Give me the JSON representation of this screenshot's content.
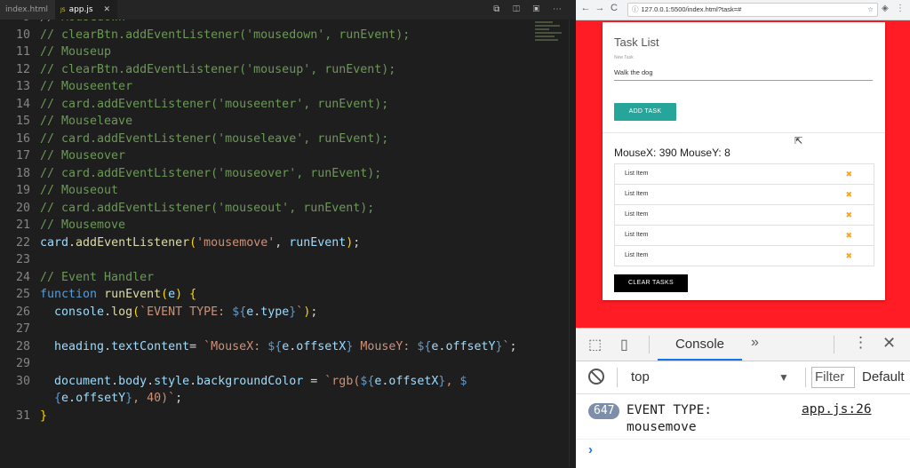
{
  "editor": {
    "tabs": [
      {
        "label": "index.html"
      },
      {
        "label": "app.js",
        "badge": "JS",
        "close": "✕"
      }
    ],
    "toolbar_icons": "⧉ ◫ ▣ ⋯",
    "lines": [
      {
        "n": "9",
        "segs": [
          [
            "c-com",
            "// Mousedown"
          ]
        ]
      },
      {
        "n": "10",
        "segs": [
          [
            "c-com",
            "// clearBtn.addEventListener('mousedown', runEvent);"
          ]
        ]
      },
      {
        "n": "11",
        "segs": [
          [
            "c-com",
            "// Mouseup"
          ]
        ]
      },
      {
        "n": "12",
        "segs": [
          [
            "c-com",
            "// clearBtn.addEventListener('mouseup', runEvent);"
          ]
        ]
      },
      {
        "n": "13",
        "segs": [
          [
            "c-com",
            "// Mouseenter"
          ]
        ]
      },
      {
        "n": "14",
        "segs": [
          [
            "c-com",
            "// card.addEventListener('mouseenter', runEvent);"
          ]
        ]
      },
      {
        "n": "15",
        "segs": [
          [
            "c-com",
            "// Mouseleave"
          ]
        ]
      },
      {
        "n": "16",
        "segs": [
          [
            "c-com",
            "// card.addEventListener('mouseleave', runEvent);"
          ]
        ]
      },
      {
        "n": "17",
        "segs": [
          [
            "c-com",
            "// Mouseover"
          ]
        ]
      },
      {
        "n": "18",
        "segs": [
          [
            "c-com",
            "// card.addEventListener('mouseover', runEvent);"
          ]
        ]
      },
      {
        "n": "19",
        "segs": [
          [
            "c-com",
            "// Mouseout"
          ]
        ]
      },
      {
        "n": "20",
        "segs": [
          [
            "c-com",
            "// card.addEventListener('mouseout', runEvent);"
          ]
        ]
      },
      {
        "n": "21",
        "segs": [
          [
            "c-com",
            "// Mousemove"
          ]
        ]
      },
      {
        "n": "22",
        "segs": [
          [
            "c-var",
            "card"
          ],
          [
            "c-w",
            "."
          ],
          [
            "c-fn",
            "addEventListener"
          ],
          [
            "c-p",
            "("
          ],
          [
            "c-str",
            "'mousemove'"
          ],
          [
            "c-w",
            ", "
          ],
          [
            "c-var",
            "runEvent"
          ],
          [
            "c-p",
            ")"
          ],
          [
            "c-w",
            ";"
          ]
        ]
      },
      {
        "n": "23",
        "segs": []
      },
      {
        "n": "24",
        "segs": [
          [
            "c-com",
            "// Event Handler"
          ]
        ]
      },
      {
        "n": "25",
        "segs": [
          [
            "c-kw",
            "function"
          ],
          [
            "c-w",
            " "
          ],
          [
            "c-fn",
            "runEvent"
          ],
          [
            "c-p",
            "("
          ],
          [
            "c-var",
            "e"
          ],
          [
            "c-p",
            ")"
          ],
          [
            "c-w",
            " "
          ],
          [
            "c-p",
            "{"
          ]
        ]
      },
      {
        "n": "26",
        "segs": [
          [
            "c-w",
            "  "
          ],
          [
            "c-var",
            "console"
          ],
          [
            "c-w",
            "."
          ],
          [
            "c-fn",
            "log"
          ],
          [
            "c-p",
            "("
          ],
          [
            "c-str",
            "`EVENT TYPE: "
          ],
          [
            "c-kw",
            "${"
          ],
          [
            "c-var",
            "e"
          ],
          [
            "c-w",
            "."
          ],
          [
            "c-var",
            "type"
          ],
          [
            "c-kw",
            "}"
          ],
          [
            "c-str",
            "`"
          ],
          [
            "c-p",
            ")"
          ],
          [
            "c-w",
            ";"
          ]
        ]
      },
      {
        "n": "27",
        "segs": []
      },
      {
        "n": "28",
        "segs": [
          [
            "c-w",
            "  "
          ],
          [
            "c-var",
            "heading"
          ],
          [
            "c-w",
            "."
          ],
          [
            "c-var",
            "textContent"
          ],
          [
            "c-w",
            "= "
          ],
          [
            "c-str",
            "`MouseX: "
          ],
          [
            "c-kw",
            "${"
          ],
          [
            "c-var",
            "e"
          ],
          [
            "c-w",
            "."
          ],
          [
            "c-var",
            "offsetX"
          ],
          [
            "c-kw",
            "}"
          ],
          [
            "c-str",
            " MouseY: "
          ],
          [
            "c-kw",
            "${"
          ],
          [
            "c-var",
            "e"
          ],
          [
            "c-w",
            "."
          ],
          [
            "c-var",
            "offsetY"
          ],
          [
            "c-kw",
            "}"
          ],
          [
            "c-str",
            "`"
          ],
          [
            "c-w",
            ";"
          ]
        ]
      },
      {
        "n": "29",
        "segs": []
      },
      {
        "n": "30",
        "segs": [
          [
            "c-w",
            "  "
          ],
          [
            "c-var",
            "document"
          ],
          [
            "c-w",
            "."
          ],
          [
            "c-var",
            "body"
          ],
          [
            "c-w",
            "."
          ],
          [
            "c-var",
            "style"
          ],
          [
            "c-w",
            "."
          ],
          [
            "c-var",
            "backgroundColor"
          ],
          [
            "c-w",
            " = "
          ],
          [
            "c-str",
            "`rgb("
          ],
          [
            "c-kw",
            "${"
          ],
          [
            "c-var",
            "e"
          ],
          [
            "c-w",
            "."
          ],
          [
            "c-var",
            "offsetX"
          ],
          [
            "c-kw",
            "}"
          ],
          [
            "c-str",
            ", "
          ],
          [
            "c-kw",
            "$"
          ]
        ]
      },
      {
        "n": "",
        "segs": [
          [
            "c-w",
            "  "
          ],
          [
            "c-kw",
            "{"
          ],
          [
            "c-var",
            "e"
          ],
          [
            "c-w",
            "."
          ],
          [
            "c-var",
            "offsetY"
          ],
          [
            "c-kw",
            "}"
          ],
          [
            "c-str",
            ", 40)`"
          ],
          [
            "c-w",
            ";"
          ]
        ]
      },
      {
        "n": "31",
        "segs": [
          [
            "c-p",
            "}"
          ]
        ]
      }
    ]
  },
  "browser": {
    "url": "127.0.0.1:5500/index.html?task=#",
    "nav": {
      "back": "←",
      "forward": "→",
      "reload": "C"
    },
    "page": {
      "card_title": "Task List",
      "field_label": "New Task",
      "field_value": "Walk the dog",
      "add_button": "ADD TASK",
      "heading": "MouseX: 390 MouseY: 8",
      "items": [
        "List Item",
        "List Item",
        "List Item",
        "List Item",
        "List Item"
      ],
      "delete_glyph": "✖",
      "clear_button": "CLEAR TASKS",
      "background": "#ff1c24"
    }
  },
  "devtools": {
    "tab_console": "Console",
    "more": "»",
    "context": "top",
    "filter_placeholder": "Filter",
    "levels": "Default",
    "log": {
      "count": "647",
      "message": "EVENT TYPE:\nmousemove",
      "source": "app.js:26"
    },
    "prompt": "›"
  }
}
